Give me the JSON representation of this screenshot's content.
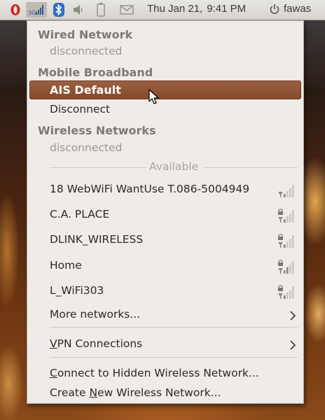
{
  "panel": {
    "clock": {
      "date": "Thu Jan 21,",
      "time": "9:41 PM"
    },
    "user": "fawas",
    "icons": [
      "opera-icon",
      "network-signal-icon",
      "bluetooth-icon",
      "volume-icon",
      "battery-icon",
      "mail-icon",
      "power-icon"
    ]
  },
  "menu": {
    "wired": {
      "header": "Wired Network",
      "status": "disconnected"
    },
    "mobile": {
      "header": "Mobile Broadband",
      "selected": "AIS Default",
      "disconnect": "Disconnect"
    },
    "wireless": {
      "header": "Wireless Networks",
      "status": "disconnected",
      "available": "Available"
    },
    "networks": [
      {
        "name": "18 WebWiFi WantUse T.086-5004949",
        "locked": false
      },
      {
        "name": "C.A. PLACE",
        "locked": true
      },
      {
        "name": "DLINK_WIRELESS",
        "locked": true
      },
      {
        "name": "Home",
        "locked": true
      },
      {
        "name": "L_WiFi303",
        "locked": true
      }
    ],
    "more_networks": "More networks...",
    "vpn": {
      "mnemonic": "V",
      "rest": "PN Connections"
    },
    "connect_hidden": {
      "mnemonic": "C",
      "rest": "onnect to Hidden Wireless Network..."
    },
    "create_new": {
      "before": "Create ",
      "mnemonic": "N",
      "after": "ew Wireless Network..."
    }
  },
  "colors": {
    "selection": "#8f5234",
    "menu_bg": "#efebe7",
    "header_text": "#7d7a76"
  }
}
